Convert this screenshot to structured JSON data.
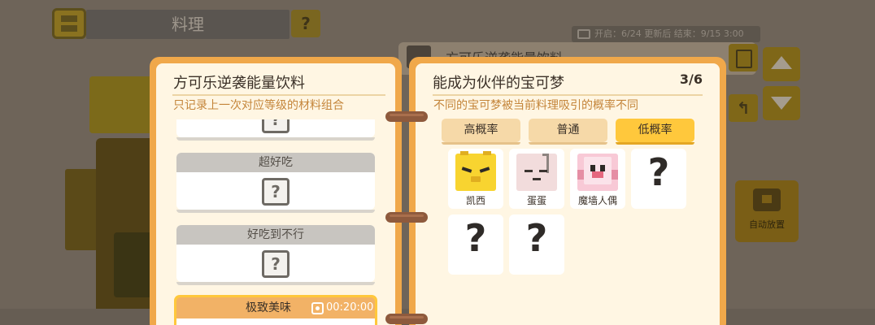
{
  "header": {
    "title": "料理",
    "help_icon": "?",
    "event_info": "开启：6/24 更新后 结束：9/15 3:00"
  },
  "background": {
    "behind_recipe_title": "方可乐逆袭能量饮料",
    "auto_cook_label": "自动放置",
    "back_icon": "↰"
  },
  "left_page": {
    "title": "方可乐逆袭能量饮料",
    "subtitle": "只记录上一次对应等级的材料组合",
    "grades": [
      {
        "label": "",
        "icon": "question-box-icon"
      },
      {
        "label": "超好吃",
        "icon": "question-box-icon"
      },
      {
        "label": "好吃到不行",
        "icon": "question-box-icon"
      }
    ],
    "best": {
      "label": "极致美味",
      "timer": "00:20:00"
    }
  },
  "right_page": {
    "title": "能成为伙伴的宝可梦",
    "count": "3/6",
    "subtitle": "不同的宝可梦被当前料理吸引的概率不同",
    "tabs": [
      {
        "label": "高概率",
        "active": false
      },
      {
        "label": "普通",
        "active": false
      },
      {
        "label": "低概率",
        "active": true
      }
    ],
    "pokemon": [
      {
        "name": "凯西",
        "known": true
      },
      {
        "name": "蛋蛋",
        "known": true
      },
      {
        "name": "魔墙人偶",
        "known": true
      },
      {
        "name": "",
        "known": false
      },
      {
        "name": "",
        "known": false
      },
      {
        "name": "",
        "known": false
      }
    ]
  },
  "colors": {
    "notebook_border": "#f0a84a",
    "paper": "#fff6e3",
    "active_tab": "#ffc83c",
    "inactive_tab": "#f6d9a8",
    "accent_text": "#c4853a"
  }
}
